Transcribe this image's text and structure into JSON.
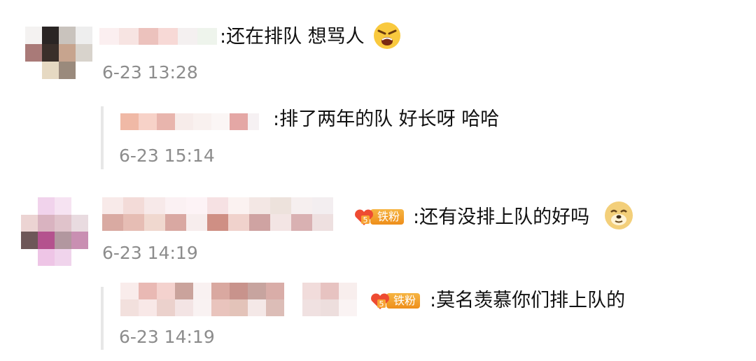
{
  "comments": [
    {
      "text": ":还在排队 想骂人",
      "time": "6-23 13:28",
      "emoji": "angry-face-icon"
    },
    {
      "text": ":排了两年的队 好长呀 哈哈",
      "time": "6-23 15:14"
    },
    {
      "text": ":还有没排上队的好吗",
      "time": "6-23 14:19",
      "badge": "铁粉",
      "emoji": "doge-face-icon"
    },
    {
      "text": ":莫名羡慕你们排上队的",
      "time": "6-23 14:19",
      "badge": "铁粉"
    }
  ],
  "colors": {
    "text": "#111111",
    "timestamp": "#8c8c8c",
    "thread_line": "#e7e7e7",
    "badge": "#f0a030"
  }
}
